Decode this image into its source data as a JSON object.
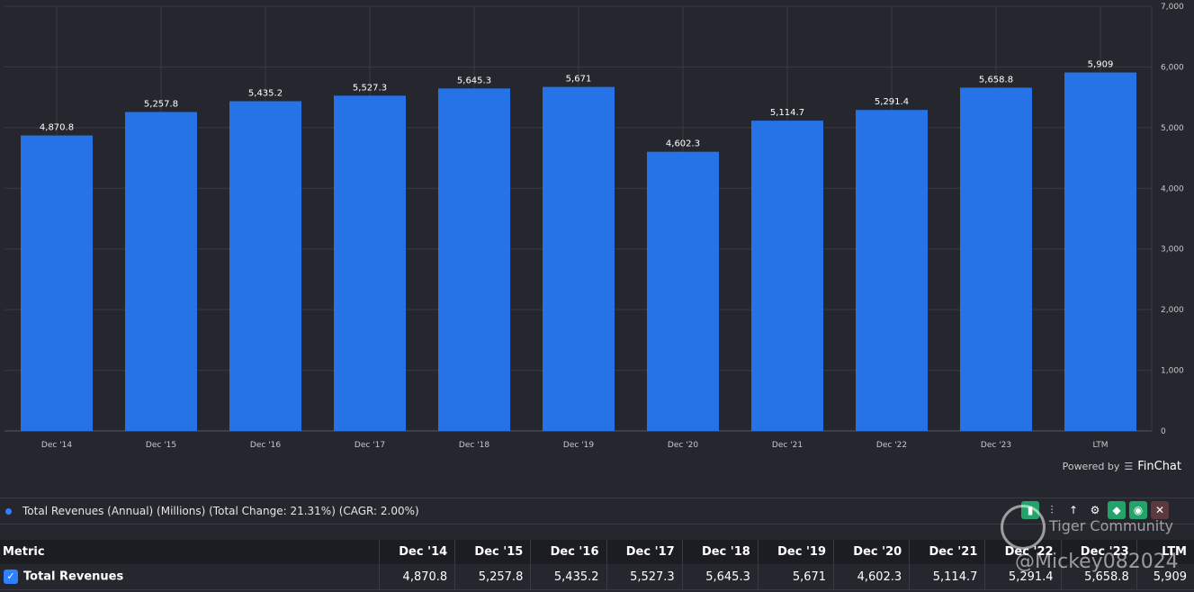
{
  "chart_data": {
    "type": "bar",
    "categories": [
      "Dec '14",
      "Dec '15",
      "Dec '16",
      "Dec '17",
      "Dec '18",
      "Dec '19",
      "Dec '20",
      "Dec '21",
      "Dec '22",
      "Dec '23",
      "LTM"
    ],
    "values": [
      4870.8,
      5257.8,
      5435.2,
      5527.3,
      5645.3,
      5671,
      4602.3,
      5114.7,
      5291.4,
      5658.8,
      5909
    ],
    "value_labels": [
      "4,870.8",
      "5,257.8",
      "5,435.2",
      "5,527.3",
      "5,645.3",
      "5,671",
      "4,602.3",
      "5,114.7",
      "5,291.4",
      "5,658.8",
      "5,909"
    ],
    "ylim": [
      0,
      7000
    ],
    "yticks": [
      "0",
      "1,000",
      "2,000",
      "3,000",
      "4,000",
      "5,000",
      "6,000",
      "7,000"
    ],
    "grid": true,
    "bar_color": "#2673e8",
    "axis_position": "right"
  },
  "powered_by": "Powered by",
  "brand": "FinChat",
  "legend": {
    "text": "Total Revenues (Annual) (Millions) (Total Change: 21.31%) (CAGR: 2.00%)",
    "color": "#2f80ff"
  },
  "table": {
    "metric_header": "Metric",
    "columns": [
      "Dec '14",
      "Dec '15",
      "Dec '16",
      "Dec '17",
      "Dec '18",
      "Dec '19",
      "Dec '20",
      "Dec '21",
      "Dec '22",
      "Dec '23",
      "LTM"
    ],
    "rows": [
      {
        "name": "Total Revenues",
        "checked": true,
        "values": [
          "4,870.8",
          "5,257.8",
          "5,435.2",
          "5,527.3",
          "5,645.3",
          "5,671",
          "4,602.3",
          "5,114.7",
          "5,291.4",
          "5,658.8",
          "5,909"
        ]
      }
    ]
  },
  "watermark": {
    "community": "Tiger Community",
    "user": "@Mickey082024"
  }
}
